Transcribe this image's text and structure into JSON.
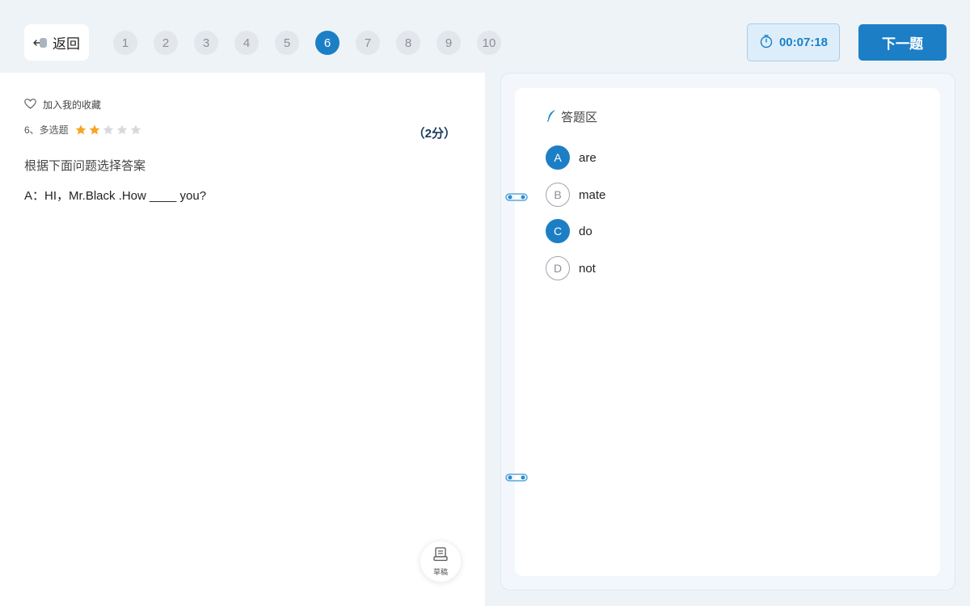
{
  "header": {
    "back_label": "返回",
    "questions": [
      {
        "label": "1",
        "active": false
      },
      {
        "label": "2",
        "active": false
      },
      {
        "label": "3",
        "active": false
      },
      {
        "label": "4",
        "active": false
      },
      {
        "label": "5",
        "active": false
      },
      {
        "label": "6",
        "active": true
      },
      {
        "label": "7",
        "active": false
      },
      {
        "label": "8",
        "active": false
      },
      {
        "label": "9",
        "active": false
      },
      {
        "label": "10",
        "active": false
      }
    ],
    "timer": "00:07:18",
    "next_label": "下一题"
  },
  "question": {
    "favorite_label": "加入我的收藏",
    "meta": "6、多选题",
    "difficulty": 2,
    "difficulty_max": 5,
    "score": "（2分）",
    "instruction": "根据下面问题选择答案",
    "stem": "A：HI，Mr.Black .How ____  you?",
    "draft_label": "草稿"
  },
  "answer_area": {
    "title": "答题区",
    "options": [
      {
        "letter": "A",
        "text": "are",
        "selected": true
      },
      {
        "letter": "B",
        "text": "mate",
        "selected": false
      },
      {
        "letter": "C",
        "text": "do",
        "selected": true
      },
      {
        "letter": "D",
        "text": "not",
        "selected": false
      }
    ]
  },
  "colors": {
    "accent": "#1c7fc6",
    "star_on": "#f5a623",
    "star_off": "#d6d9dd",
    "page_bg": "#eef3f8"
  }
}
